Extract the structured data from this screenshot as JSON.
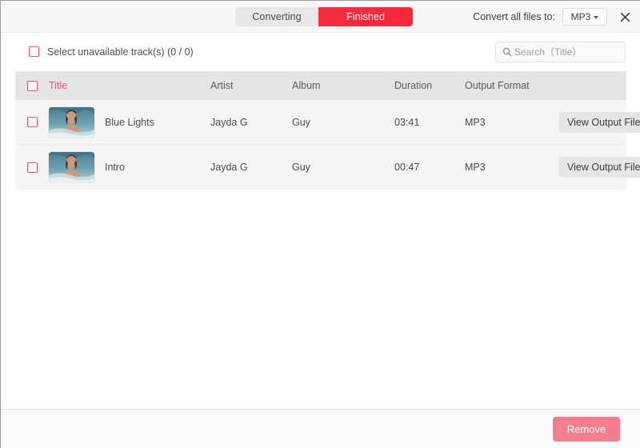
{
  "topbar": {
    "tabs": [
      {
        "label": "Converting",
        "active": false
      },
      {
        "label": "Finished",
        "active": true
      }
    ],
    "convert_all_label": "Convert all files to:",
    "format_value": "MP3",
    "format_options": [
      "MP3"
    ],
    "close_icon": "close-icon",
    "accent_color": "#f7293d"
  },
  "subbar": {
    "select_unavailable_label": "Select unavailable track(s) (0 / 0)",
    "select_unavailable_checked": false,
    "search_placeholder": "Search（Title）",
    "search_value": "",
    "search_icon": "search-icon"
  },
  "table": {
    "header_checkbox_checked": false,
    "columns": {
      "title": "Title",
      "artist": "Artist",
      "album": "Album",
      "duration": "Duration",
      "output_format": "Output Format"
    },
    "title_color": "#f1566e",
    "rows": [
      {
        "checked": false,
        "title": "Blue Lights",
        "artist": "Jayda G",
        "album": "Guy",
        "duration": "03:41",
        "output_format": "MP3",
        "action_label": "View Output File",
        "remove_icon": "close-icon",
        "thumb_alt": "album-artwork"
      },
      {
        "checked": false,
        "title": "Intro",
        "artist": "Jayda G",
        "album": "Guy",
        "duration": "00:47",
        "output_format": "MP3",
        "action_label": "View Output File",
        "remove_icon": "close-icon",
        "thumb_alt": "album-artwork"
      }
    ]
  },
  "footer": {
    "remove_label": "Remove",
    "remove_color": "#f27e8f"
  }
}
